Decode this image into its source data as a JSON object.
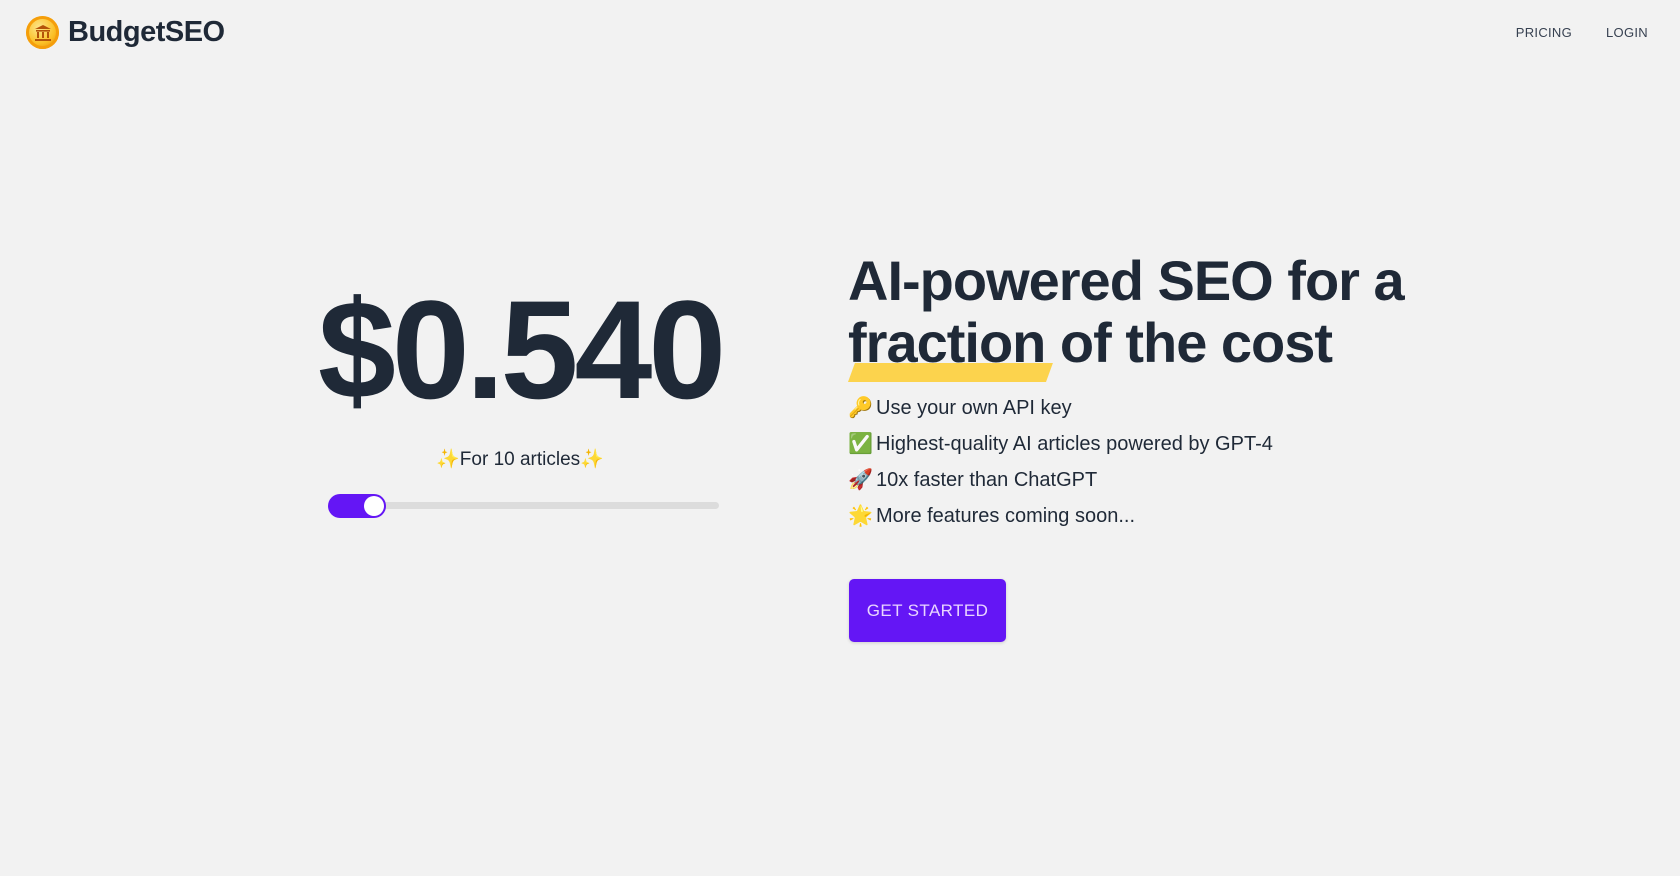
{
  "header": {
    "brand_name": "BudgetSEO",
    "nav": {
      "pricing": "PRICING",
      "login": "LOGIN"
    }
  },
  "pricing_panel": {
    "price": "$0.540",
    "articles_label": "✨For 10 articles✨",
    "slider_fraction": 0.05
  },
  "hero": {
    "headline_line1": "AI-powered SEO for a",
    "headline_highlight": "fraction",
    "headline_rest": " of the cost",
    "features": [
      {
        "emoji": "🔑",
        "text": "Use your own API key"
      },
      {
        "emoji": "✅",
        "text": "Highest-quality AI articles powered by GPT-4"
      },
      {
        "emoji": "🚀",
        "text": "10x faster than ChatGPT"
      },
      {
        "emoji": "🌟",
        "text": "More features coming soon..."
      }
    ],
    "cta_label": "GET STARTED"
  },
  "colors": {
    "background": "#f2f2f2",
    "accent": "#6416f5",
    "highlight": "#fcd34d",
    "text": "#1f2937"
  }
}
